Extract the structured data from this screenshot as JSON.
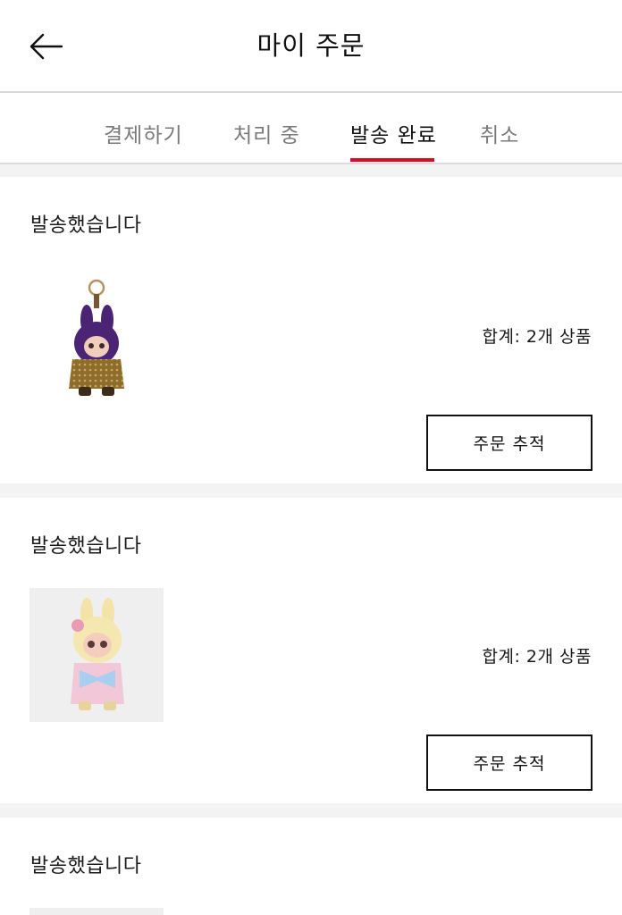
{
  "header": {
    "title": "마이 주문"
  },
  "tabs": [
    {
      "label": "결제하기"
    },
    {
      "label": "처리 중"
    },
    {
      "label": "발송 완료",
      "active": true
    },
    {
      "label": "취소"
    }
  ],
  "colors": {
    "accent": "#e00a22",
    "text": "#111111",
    "inactive_tab": "#7a7a7a"
  },
  "orders": [
    {
      "status": "발송했습니다",
      "total": "합계: 2개 상품",
      "track_label": "주문 추적",
      "thumbnail": "purple-bunny-figure-keychain"
    },
    {
      "status": "발송했습니다",
      "total": "합계: 2개 상품",
      "track_label": "주문 추적",
      "thumbnail": "yellow-bunny-figure-pink-bow"
    },
    {
      "status": "발송했습니다",
      "thumbnail": "product-thumbnail"
    }
  ],
  "icons": {
    "back": "arrow-left-icon"
  }
}
